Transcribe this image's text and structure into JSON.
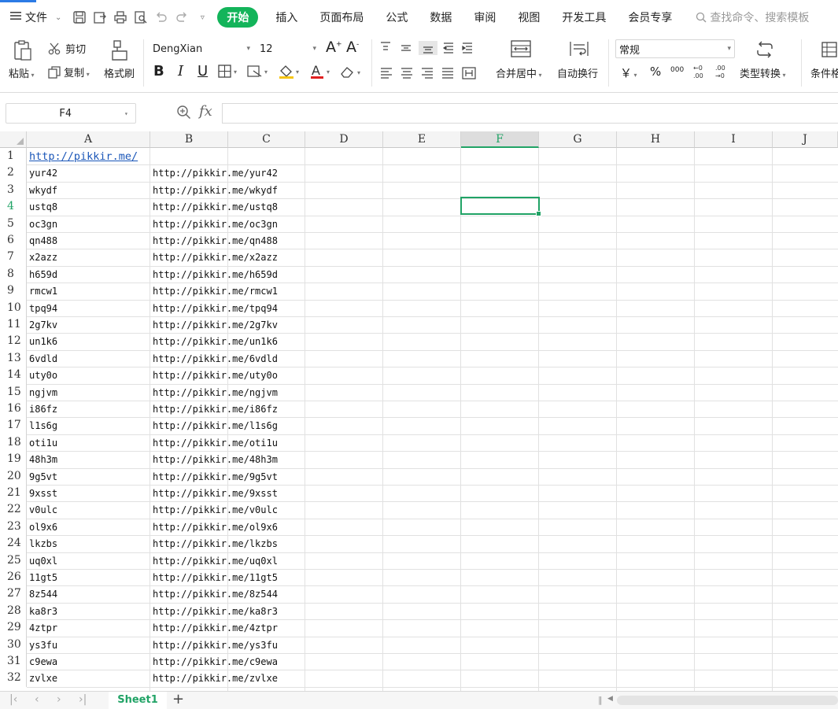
{
  "menubar": {
    "file_label": "文件",
    "tabs": [
      "开始",
      "插入",
      "页面布局",
      "公式",
      "数据",
      "审阅",
      "视图",
      "开发工具",
      "会员专享"
    ],
    "search_placeholder": "查找命令、搜索模板"
  },
  "ribbon": {
    "paste": "粘贴",
    "cut": "剪切",
    "copy": "复制",
    "format_painter": "格式刷",
    "font_name": "DengXian",
    "font_size": "12",
    "bold": "B",
    "italic": "I",
    "underline": "U",
    "merge_center": "合并居中",
    "wrap_text": "自动换行",
    "number_format": "常规",
    "currency": "￥",
    "percent": "%",
    "thousands": "000",
    "type_convert": "类型转换",
    "conditional": "条件格"
  },
  "formula_bar": {
    "name_box": "F4",
    "fx": "fx",
    "value": ""
  },
  "grid": {
    "columns": [
      "A",
      "B",
      "C",
      "D",
      "E",
      "F",
      "G",
      "H",
      "I",
      "J"
    ],
    "active_column": "F",
    "active_row": 4,
    "row_numbers": [
      "1",
      "2",
      "3",
      "4",
      "5",
      "6",
      "7",
      "8",
      "9",
      "10",
      "11",
      "12",
      "13",
      "14",
      "15",
      "16",
      "17",
      "18",
      "19",
      "20",
      "21",
      "22",
      "23",
      "24",
      "25",
      "26",
      "27",
      "28",
      "29",
      "30",
      "31",
      "32"
    ],
    "colA": [
      "http://pikkir.me/",
      "yur42",
      "wkydf",
      "ustq8",
      "oc3gn",
      "qn488",
      "x2azz",
      "h659d",
      "rmcw1",
      "tpq94",
      "2g7kv",
      "un1k6",
      "6vdld",
      "uty0o",
      "ngjvm",
      "i86fz",
      "l1s6g",
      "oti1u",
      "48h3m",
      "9g5vt",
      "9xsst",
      "v0ulc",
      "ol9x6",
      "lkzbs",
      "uq0xl",
      "11gt5",
      "8z544",
      "ka8r3",
      "4ztpr",
      "ys3fu",
      "c9ewa",
      "zvlxe"
    ],
    "colB": [
      "",
      "http://pikkir.me/yur42",
      "http://pikkir.me/wkydf",
      "http://pikkir.me/ustq8",
      "http://pikkir.me/oc3gn",
      "http://pikkir.me/qn488",
      "http://pikkir.me/x2azz",
      "http://pikkir.me/h659d",
      "http://pikkir.me/rmcw1",
      "http://pikkir.me/tpq94",
      "http://pikkir.me/2g7kv",
      "http://pikkir.me/un1k6",
      "http://pikkir.me/6vdld",
      "http://pikkir.me/uty0o",
      "http://pikkir.me/ngjvm",
      "http://pikkir.me/i86fz",
      "http://pikkir.me/l1s6g",
      "http://pikkir.me/oti1u",
      "http://pikkir.me/48h3m",
      "http://pikkir.me/9g5vt",
      "http://pikkir.me/9xsst",
      "http://pikkir.me/v0ulc",
      "http://pikkir.me/ol9x6",
      "http://pikkir.me/lkzbs",
      "http://pikkir.me/uq0xl",
      "http://pikkir.me/11gt5",
      "http://pikkir.me/8z544",
      "http://pikkir.me/ka8r3",
      "http://pikkir.me/4ztpr",
      "http://pikkir.me/ys3fu",
      "http://pikkir.me/c9ewa",
      "http://pikkir.me/zvlxe"
    ]
  },
  "sheets": {
    "active": "Sheet1"
  },
  "colors": {
    "accent_green": "#21a366",
    "start_tab": "#13b45a",
    "link_blue": "#1a56b8"
  }
}
